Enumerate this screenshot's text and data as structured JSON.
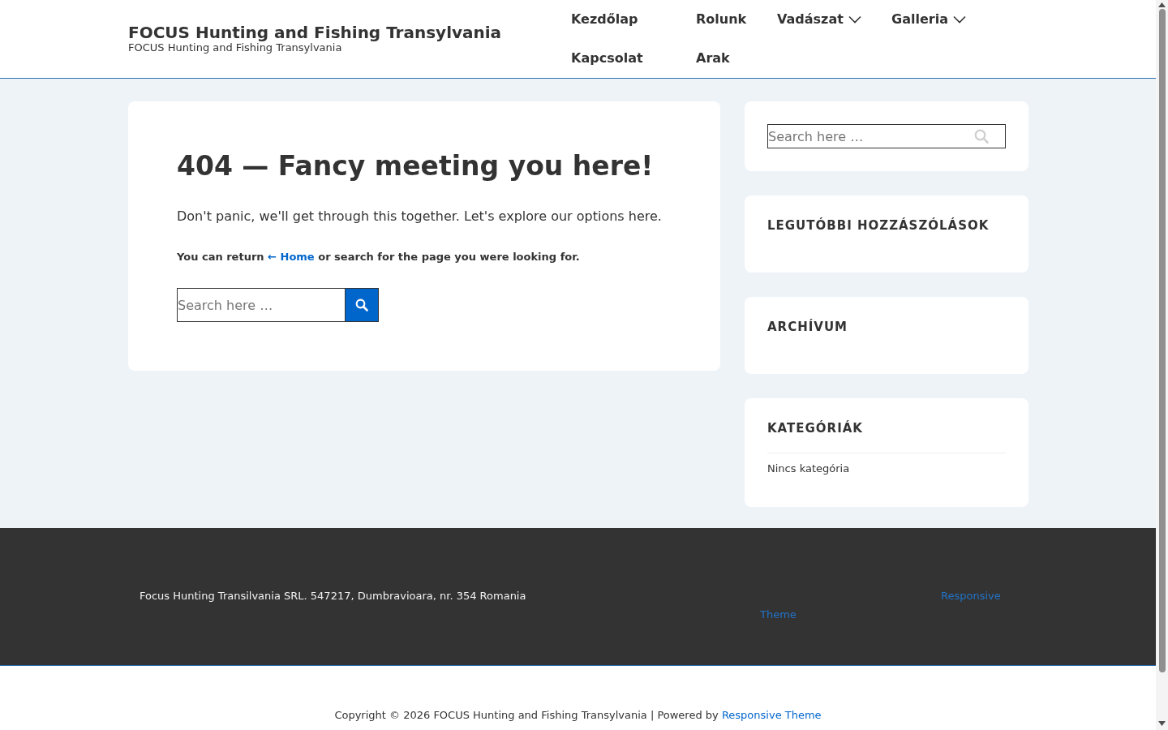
{
  "header": {
    "site_title": "FOCUS Hunting and Fishing Transylvania",
    "tagline": "FOCUS Hunting and Fishing Transylvania",
    "nav": [
      {
        "label": "Kezdőlap",
        "has_submenu": false
      },
      {
        "label": "Rolunk",
        "has_submenu": false
      },
      {
        "label": "Vadászat",
        "has_submenu": true
      },
      {
        "label": "Galleria",
        "has_submenu": true
      },
      {
        "label": "Kapcsolat",
        "has_submenu": false
      },
      {
        "label": "Arak",
        "has_submenu": false
      }
    ]
  },
  "main": {
    "title": "404 — Fancy meeting you here!",
    "intro": "Don't panic, we'll get through this together. Let's explore our options here.",
    "return_text": {
      "before": "You can return",
      "link": "← Home",
      "after": "or search for the page you were looking for."
    },
    "search": {
      "placeholder": "Search here …"
    }
  },
  "sidebar": {
    "search": {
      "placeholder": "Search here …"
    },
    "widgets": [
      {
        "title": "LEGUTÓBBI HOZZÁSZÓLÁSOK"
      },
      {
        "title": "ARCHÍVUM"
      },
      {
        "title": "KATEGÓRIÁK",
        "items": [
          "Nincs kategória"
        ]
      }
    ]
  },
  "footer": {
    "address": "Focus Hunting Transilvania SRL. 547217, Dumbravioara, nr. 354 Romania",
    "credit_link": [
      "Responsive",
      "Theme"
    ]
  },
  "copyright": {
    "text": "Copyright © 2026 FOCUS Hunting and Fishing Transylvania | Powered by",
    "link": "Responsive Theme"
  }
}
